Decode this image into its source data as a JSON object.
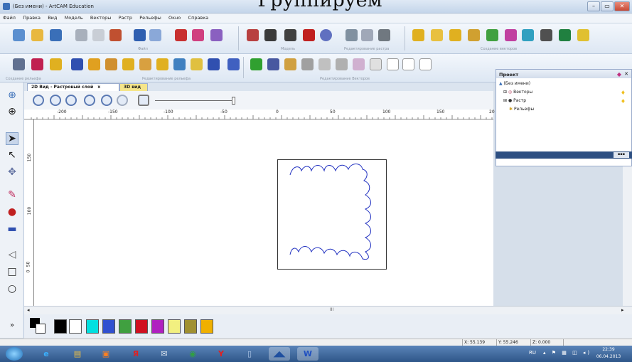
{
  "caption": "Группируем",
  "window": {
    "title": "(Без имени) - ArtCAM Education",
    "min": "–",
    "max": "▭",
    "close": "✕"
  },
  "menu": [
    "Файл",
    "Правка",
    "Вид",
    "Модель",
    "Векторы",
    "Растр",
    "Рельефы",
    "Окно",
    "Справка"
  ],
  "toolbar_groups": {
    "file": "Файл",
    "model": "Модель",
    "raster_edit": "Редактирование растра",
    "vector_create": "Создание векторов",
    "relief_create": "Создание рельефа",
    "relief_edit": "Редактирование рельефа",
    "vector_edit": "Редактирование Векторов"
  },
  "tabs": {
    "tab2d": "2D Вид - Растровый слой",
    "close": "x",
    "tab3d": "3D вид"
  },
  "ruler_h": [
    "-200",
    "-150",
    "-100",
    "-50",
    "0",
    "50",
    "100",
    "150",
    "20"
  ],
  "ruler_v": [
    "150",
    "100",
    "50",
    "0"
  ],
  "project": {
    "title": "Проект",
    "root": "(Без имени)",
    "items": [
      "Векторы",
      "Растр",
      "Рельефы"
    ]
  },
  "scroll": {
    "mid": "III"
  },
  "status": {
    "x": "X: 55.139",
    "y": "Y: 55.246",
    "z": "Z: 0.000"
  },
  "taskbar": {
    "lang": "RU",
    "time": "22:39",
    "date": "06.04.2013"
  },
  "palette": [
    "#000000",
    "#ffffff",
    "#00e0e0",
    "#3050d0",
    "#40a040",
    "#d01020",
    "#b020c0",
    "#f2f080",
    "#a09030",
    "#f0b000"
  ],
  "colors": {
    "accent": "#2d4f82",
    "curve": "#2030c0"
  }
}
